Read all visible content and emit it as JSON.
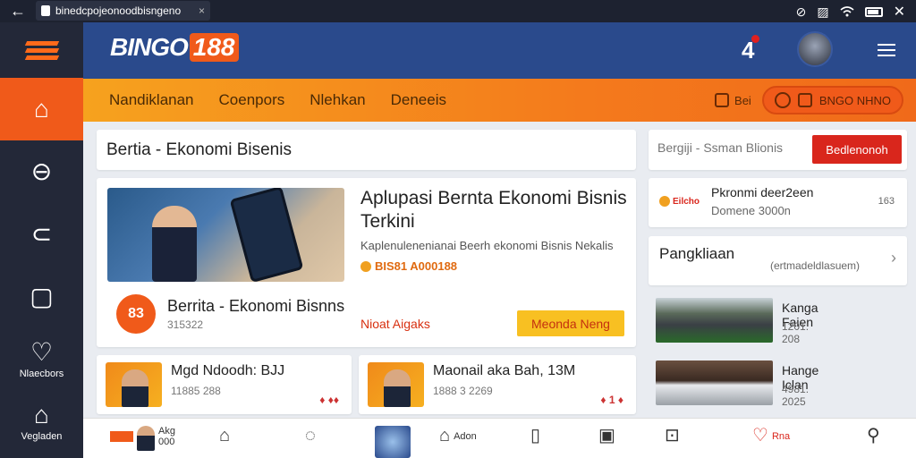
{
  "statusbar": {
    "back_icon": "←",
    "url": "binedcpojeonoodbisngeno",
    "close": "×",
    "icons": [
      "⊘",
      "▨",
      "wifi"
    ]
  },
  "rail": {
    "items": [
      {
        "icon": "⌂",
        "label": "",
        "active": true
      },
      {
        "icon": "⊖",
        "label": ""
      },
      {
        "icon": "⊂",
        "label": ""
      },
      {
        "icon": "▢",
        "label": ""
      },
      {
        "icon": "♡",
        "label": "Nlaecbors"
      },
      {
        "icon": "⌂",
        "label": "Vegladen"
      }
    ]
  },
  "header": {
    "brand_text": "BINGO",
    "brand_number": "188",
    "notif": "4"
  },
  "nav": {
    "tabs": [
      "Nandiklanan",
      "Coenpors",
      "Nlehkan",
      "Deneeis"
    ],
    "pill1_label": "Bei",
    "pill2_label": "BNGO NHNO"
  },
  "main": {
    "section_title": "Bertia - Ekonomi Bisenis",
    "feature": {
      "title": "Aplupasi Bernta Ekonomi Bisnis Terkini",
      "desc": "Kaplenulenenianai Beerh ekonomi Bisnis Nekalis",
      "brandline": "BIS81 A000188",
      "badge": "83",
      "sub_title": "Berrita - Ekonomi Bisnns",
      "sub_num": "315322",
      "hot": "Nioat Aigaks",
      "cta": "Meonda Neng"
    },
    "minis": [
      {
        "name": "Mgd Ndoodh: BJJ",
        "num": "11885 288",
        "acts": "♦ ♦♦"
      },
      {
        "name": "Maonail aka Bah, 13M",
        "num": "1888 3 2269",
        "acts": "♦ 1 ♦"
      }
    ]
  },
  "right": {
    "search_placeholder": "Bergiji - Ssman Blionis",
    "search_button": "Bedlenonoh",
    "promo": {
      "logo": "Eilcho",
      "t1": "Pkronmi deer2een",
      "t2": "Domene 3000n",
      "t3": "163"
    },
    "pangk": {
      "t1": "Pangkliaan",
      "t2": "(ertmadeldlasuem)",
      "chev": "›"
    },
    "news": [
      {
        "t1": "Kanga Faien",
        "t2": "1201: 208"
      },
      {
        "t1": "Hange Iclan",
        "t2": "4981: 2025"
      }
    ]
  },
  "bottom": {
    "items": [
      {
        "icon": "",
        "label": "Akg 000"
      },
      {
        "icon": "⌂",
        "label": ""
      },
      {
        "icon": "◌",
        "label": ""
      },
      {
        "icon": "◉",
        "label": ""
      },
      {
        "icon": "⌂",
        "label": "Adon"
      },
      {
        "icon": "▯",
        "label": ""
      },
      {
        "icon": "▣",
        "label": ""
      },
      {
        "icon": "⊡",
        "label": ""
      },
      {
        "icon": "♡",
        "label": "Rna"
      },
      {
        "icon": "⚲",
        "label": ""
      }
    ]
  },
  "colors": {
    "accent": "#f05a1a",
    "header": "#2a4a8c",
    "rail": "#232838",
    "cta": "#f8c022",
    "button_red": "#d9261c"
  }
}
